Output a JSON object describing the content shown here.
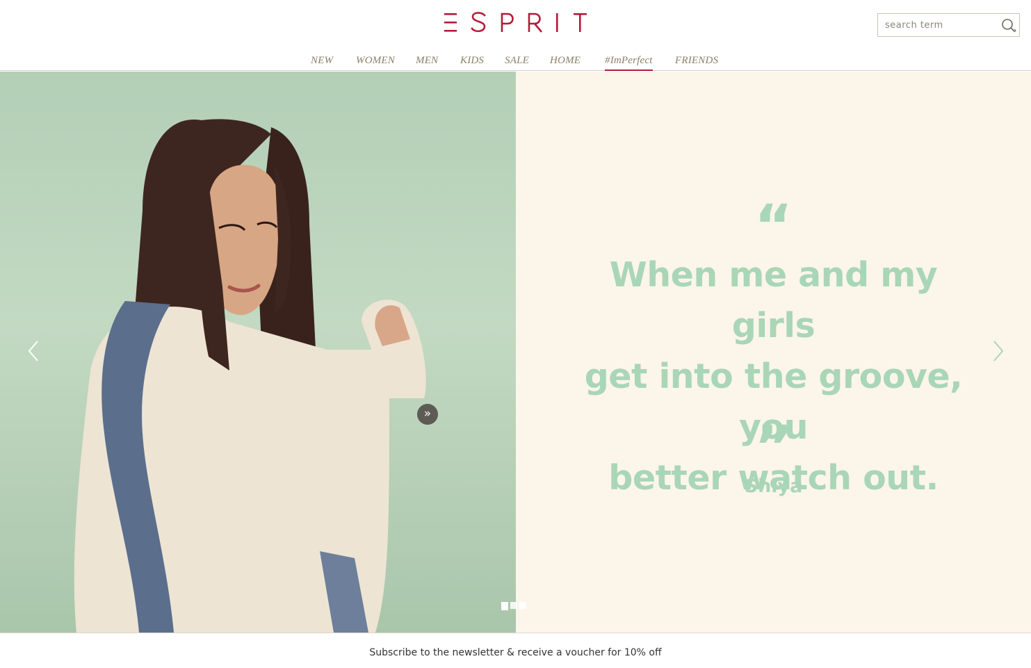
{
  "brand": {
    "logo_text": "ESPRIT",
    "color": "#b51a38"
  },
  "search": {
    "placeholder": "search term",
    "icon": "search-icon"
  },
  "nav": {
    "items": [
      {
        "label": "NEW"
      },
      {
        "label": "WOMEN"
      },
      {
        "label": "MEN"
      },
      {
        "label": "KIDS"
      },
      {
        "label": "SALE"
      },
      {
        "label": "HOME"
      },
      {
        "label": "#ImPerfect",
        "active": true
      },
      {
        "label": "FRIENDS"
      }
    ]
  },
  "hero": {
    "quote_open": "“",
    "quote_lines": [
      "When me and my girls",
      "get into the groove, you",
      "better watch out."
    ],
    "quote_close": "”",
    "author": "Shiya",
    "more_label": "»",
    "slides": {
      "count": 3,
      "current": 1
    },
    "colors": {
      "quote": "#a9d6b6",
      "panel": "#fcf5ea",
      "photo_bg": "#bcd5bd"
    }
  },
  "newsletter": {
    "text": "Subscribe to the newsletter & receive a voucher for 10% off"
  }
}
